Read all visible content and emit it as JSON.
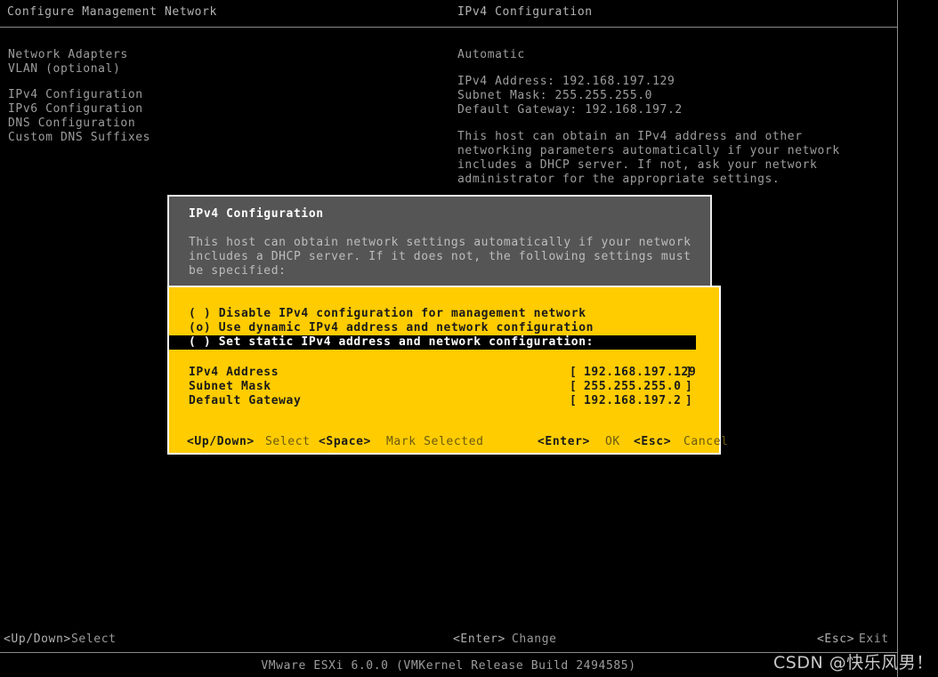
{
  "header": {
    "left_title": "Configure Management Network",
    "right_title": "IPv4 Configuration"
  },
  "menu": {
    "items": [
      {
        "label": "Network Adapters"
      },
      {
        "label": "VLAN (optional)"
      },
      {
        "label": "IPv4 Configuration"
      },
      {
        "label": "IPv6 Configuration"
      },
      {
        "label": "DNS Configuration"
      },
      {
        "label": "Custom DNS Suffixes"
      }
    ]
  },
  "detail": {
    "mode": "Automatic",
    "ipv4_address": "IPv4 Address: 192.168.197.129",
    "subnet_mask": "Subnet Mask: 255.255.255.0",
    "default_gateway": "Default Gateway: 192.168.197.2",
    "description": "This host can obtain an IPv4 address and other networking parameters automatically if your network includes a DHCP server. If not, ask your network administrator for the appropriate settings."
  },
  "dialog": {
    "title": "IPv4 Configuration",
    "description": "This host can obtain network settings automatically if your network includes a DHCP server. If it does not, the following settings must be specified:",
    "options": [
      {
        "marker": "( )",
        "label": "Disable IPv4 configuration for management network",
        "selected": false
      },
      {
        "marker": "(o)",
        "label": "Use dynamic IPv4 address and network configuration",
        "selected": false
      },
      {
        "marker": "( )",
        "label": "Set static IPv4 address and network configuration:",
        "selected": true
      }
    ],
    "fields": [
      {
        "label": "IPv4 Address",
        "open": "[",
        "value": "192.168.197.129",
        "close": "]"
      },
      {
        "label": "Subnet Mask",
        "open": "[",
        "value": "255.255.255.0",
        "close": "]"
      },
      {
        "label": "Default Gateway",
        "open": "[",
        "value": "192.168.197.2",
        "close": "]"
      }
    ],
    "footer": {
      "updown_key": "<Up/Down>",
      "updown_desc": "Select",
      "space_key": "<Space>",
      "space_desc": "Mark Selected",
      "enter_key": "<Enter>",
      "enter_desc": "OK",
      "esc_key": "<Esc>",
      "esc_desc": "Cancel"
    }
  },
  "statusbar": {
    "updown_key": "<Up/Down>",
    "updown_desc": "Select",
    "enter_key": "<Enter>",
    "enter_desc": "Change",
    "esc_key": "<Esc>",
    "esc_desc": "Exit",
    "version": "VMware ESXi 6.0.0 (VMKernel Release Build 2494585)"
  },
  "watermark": {
    "text": "CSDN @快乐风男！"
  },
  "colors": {
    "background": "#000000",
    "text": "#9d9d9d",
    "dialog_header_bg": "#555555",
    "dialog_body_bg": "#ffcc00",
    "dialog_border": "#ffffff",
    "selection_bg": "#000000",
    "selection_fg": "#ffffff"
  }
}
